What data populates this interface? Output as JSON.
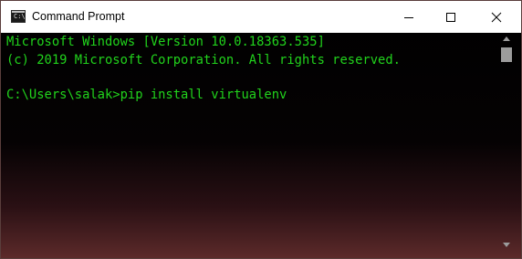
{
  "window": {
    "title": "Command Prompt",
    "icon": "cmd-icon",
    "icon_glyph": "C:\\",
    "controls": [
      "minimize-icon",
      "maximize-icon",
      "close-icon"
    ]
  },
  "console": {
    "lines": [
      "Microsoft Windows [Version 10.0.18363.535]",
      "(c) 2019 Microsoft Corporation. All rights reserved.",
      "C:\\Users\\salak>pip install virtualenv"
    ],
    "text_color": "#21d31c"
  },
  "scrollbar": {
    "up_icon": "arrow-up-icon",
    "down_icon": "arrow-down-icon"
  }
}
